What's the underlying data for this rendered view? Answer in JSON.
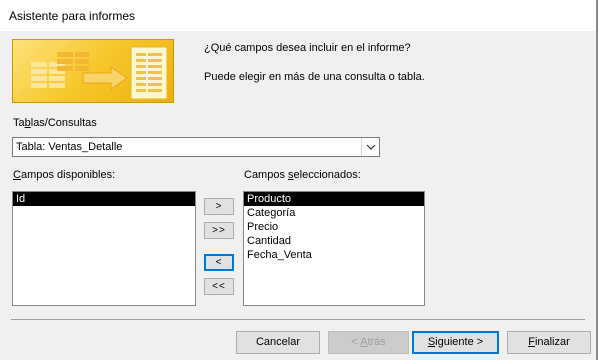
{
  "window": {
    "title": "Asistente para informes"
  },
  "intro": {
    "question": "¿Qué campos desea incluir en el informe?",
    "help": "Puede elegir en más de una consulta o tabla."
  },
  "tables_label": {
    "pre": "Ta",
    "key": "b",
    "post": "las/Consultas"
  },
  "combo": {
    "value": "Tabla: Ventas_Detalle",
    "icon": "chevron-down-icon"
  },
  "available_label": {
    "key": "C",
    "post": "ampos disponibles:"
  },
  "available_fields": [
    {
      "label": "Id",
      "selected": true
    }
  ],
  "selected_label": {
    "pre": "Campos ",
    "key": "s",
    "post": "eleccionados:"
  },
  "selected_fields": [
    {
      "label": "Producto",
      "selected": true
    },
    {
      "label": "Categoría",
      "selected": false
    },
    {
      "label": "Precio",
      "selected": false
    },
    {
      "label": "Cantidad",
      "selected": false
    },
    {
      "label": "Fecha_Venta",
      "selected": false
    }
  ],
  "move_buttons": {
    "add_one": ">",
    "add_all": ">>",
    "remove_one": "<",
    "remove_all": "<<"
  },
  "footer": {
    "cancel": "Cancelar",
    "back": {
      "pre": "< ",
      "key": "A",
      "post": "trás"
    },
    "next": {
      "key": "S",
      "post": "iguiente >"
    },
    "finish": {
      "key": "F",
      "post": "inalizar"
    }
  }
}
